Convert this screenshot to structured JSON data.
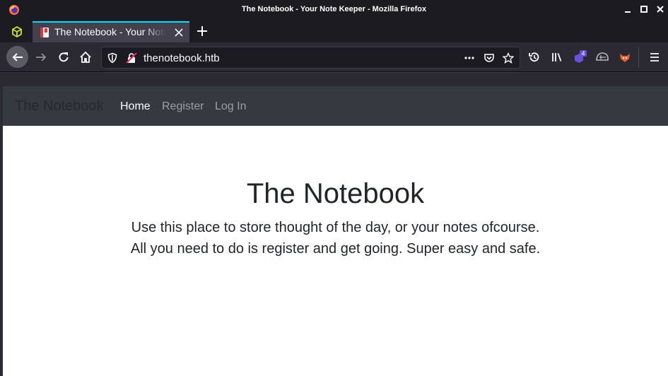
{
  "window": {
    "title": "The Notebook - Your Note Keeper - Mozilla Firefox"
  },
  "tabs": [
    {
      "title": "The Notebook - Your Note Keeper",
      "active": true
    }
  ],
  "urlbar": {
    "url": "thenotebook.htb"
  },
  "extensions": {
    "badge_count": "4"
  },
  "site": {
    "brand": "The Notebook",
    "nav": [
      {
        "label": "Home",
        "active": true
      },
      {
        "label": "Register",
        "active": false
      },
      {
        "label": "Log In",
        "active": false
      }
    ],
    "hero": {
      "title": "The Notebook",
      "line1": "Use this place to store thought of the day, or your notes ofcourse.",
      "line2": "All you need to do is register and get going. Super easy and safe."
    }
  },
  "colors": {
    "accent": "#00ddff",
    "site_navbar": "#343a40",
    "chrome": "#1c1b22"
  }
}
